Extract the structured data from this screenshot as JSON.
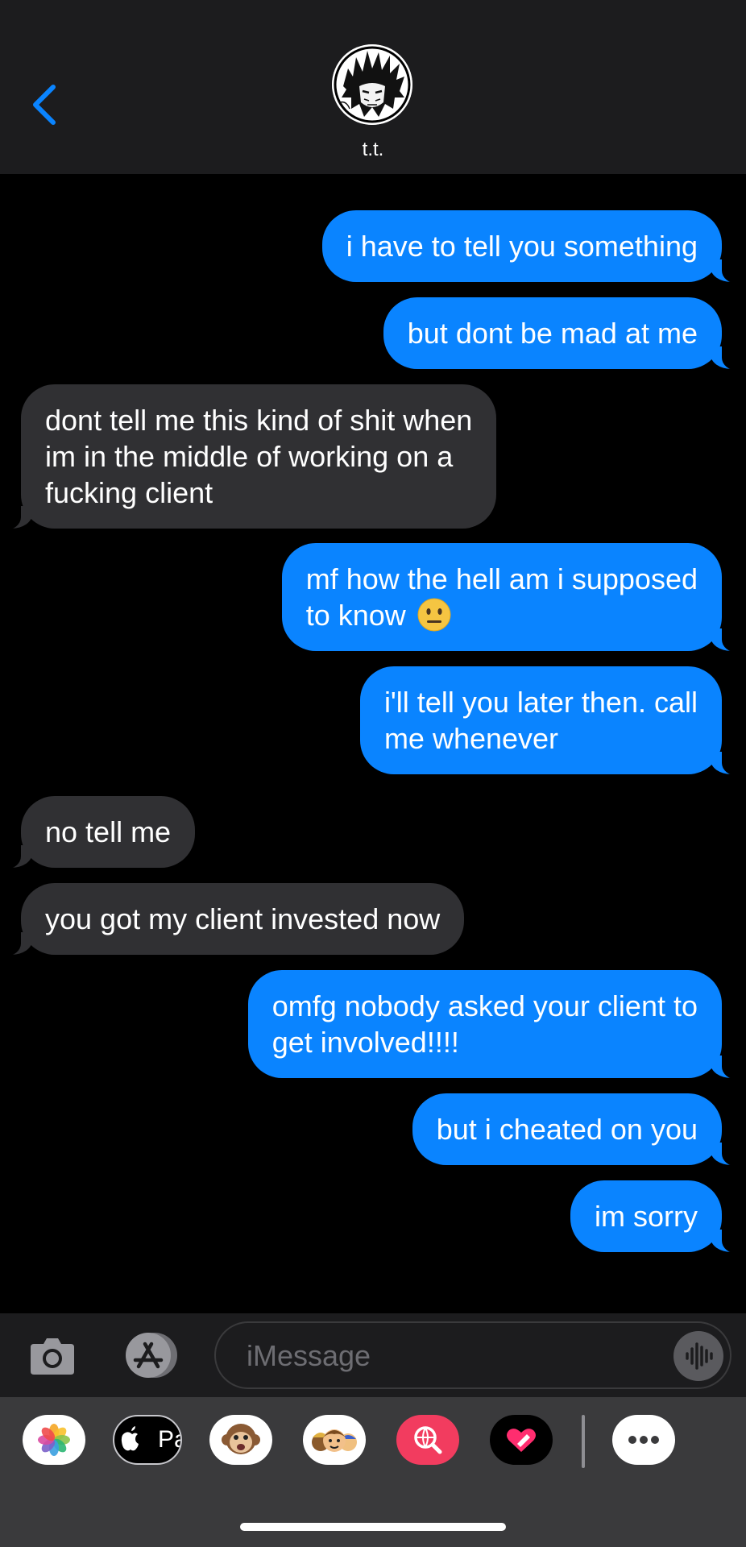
{
  "header": {
    "contact_name": "t.t.",
    "back_icon": "chevron-left-icon",
    "accent_color": "#0a84ff"
  },
  "messages": [
    {
      "side": "sent",
      "text": "i have to tell you something"
    },
    {
      "side": "sent",
      "text": "but dont be mad at me"
    },
    {
      "side": "received",
      "lines": [
        "dont tell me this kind of shit when",
        "im in the middle of working on a",
        "fucking client"
      ]
    },
    {
      "side": "sent",
      "lines": [
        "mf how the hell am i supposed",
        "to know"
      ],
      "emoji": "neutral-face-emoji"
    },
    {
      "side": "sent",
      "lines": [
        "i'll tell you later then. call",
        "me whenever"
      ]
    },
    {
      "side": "received",
      "text": "no tell me"
    },
    {
      "side": "received",
      "text": "you got my client invested now"
    },
    {
      "side": "sent",
      "lines": [
        "omfg nobody asked your client to",
        "get involved!!!!"
      ]
    },
    {
      "side": "sent",
      "text": "but i cheated on you"
    },
    {
      "side": "sent",
      "text": "im sorry"
    }
  ],
  "input_bar": {
    "placeholder": "iMessage",
    "camera_icon": "camera-icon",
    "apps_icon": "app-store-icon",
    "audio_icon": "audio-waveform-icon"
  },
  "app_drawer": {
    "apps": [
      {
        "name": "photos",
        "icon": "photos-icon"
      },
      {
        "name": "apple-pay",
        "icon": "apple-pay-icon",
        "label": "Pay"
      },
      {
        "name": "animoji",
        "icon": "monkey-animoji-icon"
      },
      {
        "name": "memoji",
        "icon": "memoji-stickers-icon"
      },
      {
        "name": "image-search",
        "icon": "globe-search-icon"
      },
      {
        "name": "digital-touch",
        "icon": "heart-touch-icon"
      },
      {
        "name": "more",
        "icon": "more-icon"
      }
    ]
  },
  "colors": {
    "sent_bubble": "#0a84ff",
    "received_bubble": "#303033",
    "background": "#000000",
    "header": "#1c1c1e"
  }
}
